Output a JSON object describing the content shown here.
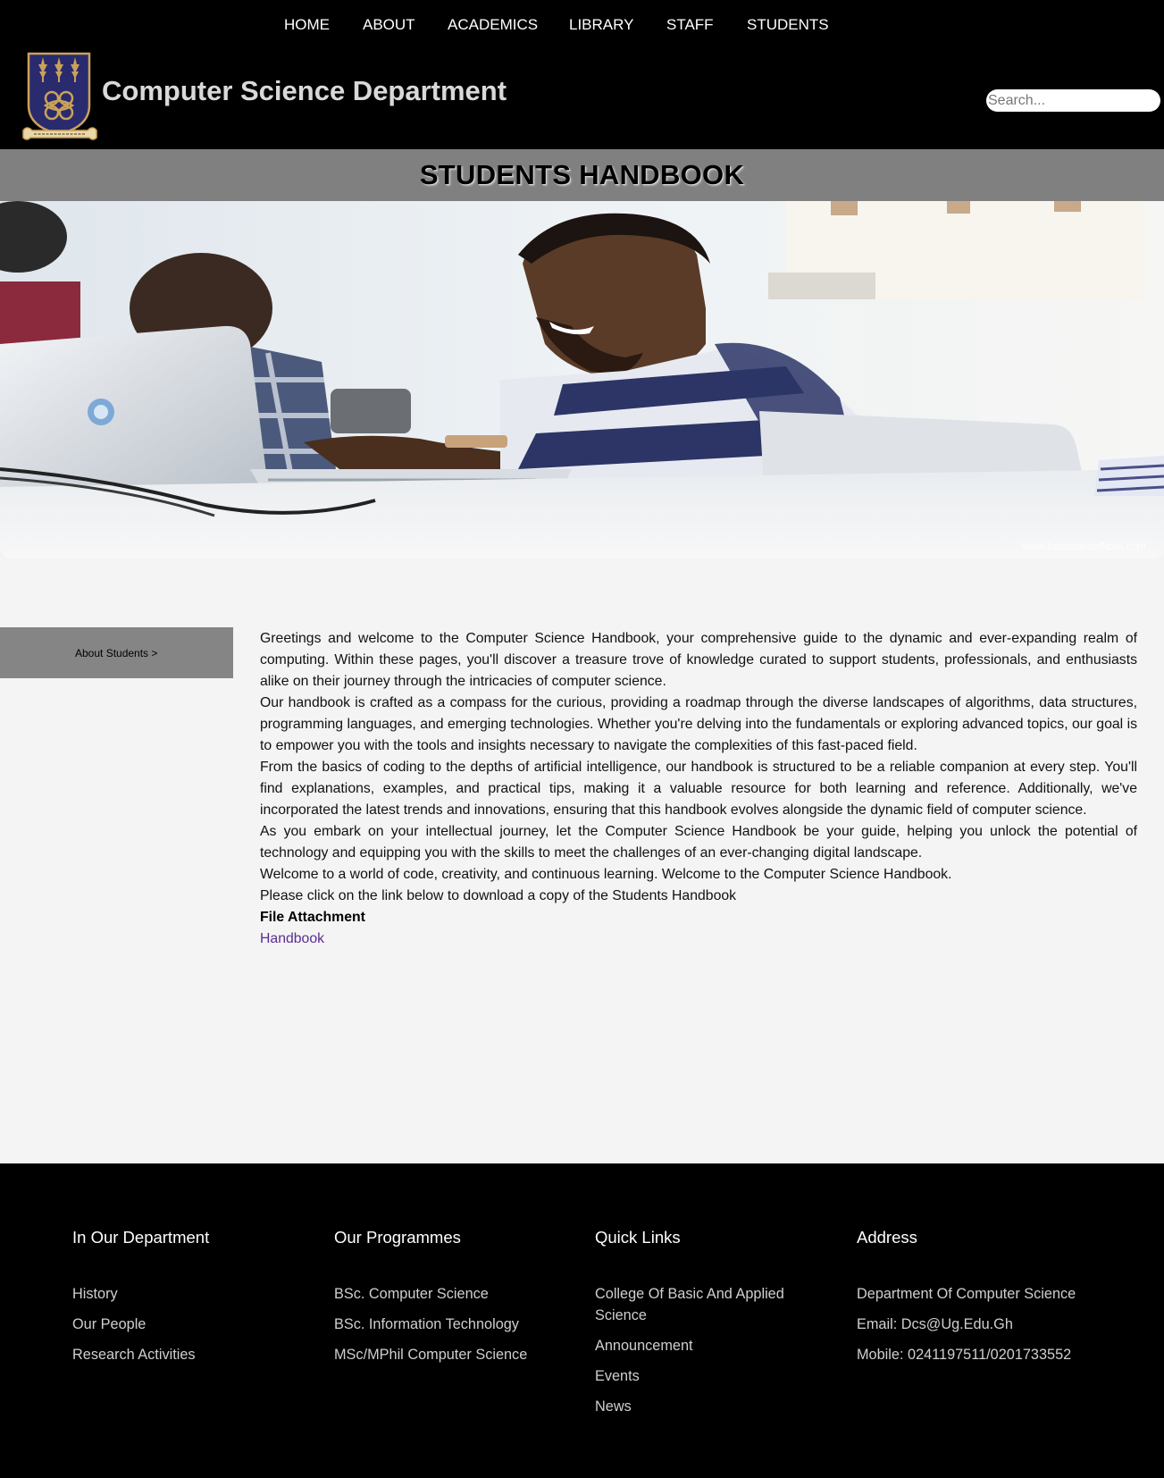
{
  "nav": {
    "items": [
      "HOME",
      "ABOUT",
      "ACADEMICS",
      "LIBRARY",
      "STAFF",
      "STUDENTS"
    ]
  },
  "header": {
    "site_title": "Computer Science Department",
    "logo_icon": "university-crest-icon",
    "search_placeholder": "Search..."
  },
  "page": {
    "title": "STUDENTS HANDBOOK"
  },
  "hero": {
    "watermark": "www.bsstudiosofficial.com"
  },
  "sidebar": {
    "link_label": "About Students >"
  },
  "article": {
    "paragraphs": [
      "Greetings and welcome to the Computer Science Handbook, your comprehensive guide to the dynamic and ever-expanding realm of computing. Within these pages, you'll discover a treasure trove of knowledge curated to support students, professionals, and enthusiasts alike on their journey through the intricacies of computer science.",
      "Our handbook is crafted as a compass for the curious, providing a roadmap through the diverse landscapes of algorithms, data structures, programming languages, and emerging technologies. Whether you're delving into the fundamentals or exploring advanced topics, our goal is to empower you with the tools and insights necessary to navigate the complexities of this fast-paced field.",
      "From the basics of coding to the depths of artificial intelligence, our handbook is structured to be a reliable companion at every step. You'll find explanations, examples, and practical tips, making it a valuable resource for both learning and reference. Additionally, we've incorporated the latest trends and innovations, ensuring that this handbook evolves alongside the dynamic field of computer science.",
      "As you embark on your intellectual journey, let the Computer Science Handbook be your guide, helping you unlock the potential of technology and equipping you with the skills to meet the challenges of an ever-changing digital landscape.",
      "Welcome to a world of code, creativity, and continuous learning. Welcome to the Computer Science Handbook.",
      "Please click on the link below to download a copy of the Students Handbook"
    ],
    "attachment_label": "File Attachment",
    "attachment_link": "Handbook"
  },
  "footer": {
    "department": {
      "heading": "In Our Department",
      "links": [
        "History",
        "Our People",
        "Research Activities"
      ]
    },
    "programmes": {
      "heading": "Our Programmes",
      "links": [
        "BSc. Computer Science",
        "BSc. Information Technology",
        "MSc/MPhil Computer Science"
      ]
    },
    "quick_links": {
      "heading": "Quick Links",
      "links": [
        "College Of Basic And Applied Science",
        "Announcement",
        "Events",
        "News"
      ]
    },
    "address": {
      "heading": "Address",
      "lines": [
        "Department Of Computer Science",
        "Email: Dcs@Ug.Edu.Gh",
        "Mobile: 0241197511/0201733552"
      ]
    }
  },
  "colors": {
    "header_bg": "#000000",
    "title_bar_bg": "#808080",
    "sidebar_button_bg": "#858585",
    "page_bg": "#f4f4f4",
    "link": "#5b2d91",
    "crest_navy": "#2a2a6e",
    "crest_gold": "#c9a25a"
  }
}
